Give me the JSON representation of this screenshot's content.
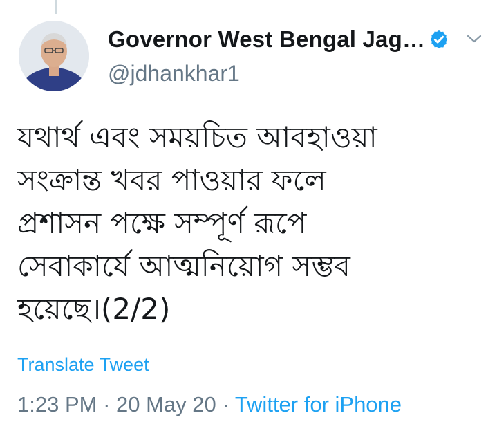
{
  "tweet": {
    "author": {
      "display_name": "Governor West Bengal Jag…",
      "handle": "@jdhankhar1",
      "verified": true,
      "avatar_icon": "profile-photo"
    },
    "menu_icon": "chevron-down-icon",
    "body": "যথার্থ এবং সময়চিত আবহাওয়া\nসংক্রান্ত খবর পাওয়ার  ফলে\nপ্রশাসন পক্ষে সম্পূর্ণ রূপে\nসেবাকার্যে আত্মনিয়োগ সম্ভব\nহয়েছে।(2/2)",
    "translate_label": "Translate Tweet",
    "time": "1:23 PM",
    "separator": "·",
    "date": "20 May 20",
    "source": "Twitter for iPhone"
  },
  "colors": {
    "link": "#1da1f2",
    "secondary_text": "#657786",
    "primary_text": "#14171a",
    "thread_line": "#cfd9de"
  }
}
